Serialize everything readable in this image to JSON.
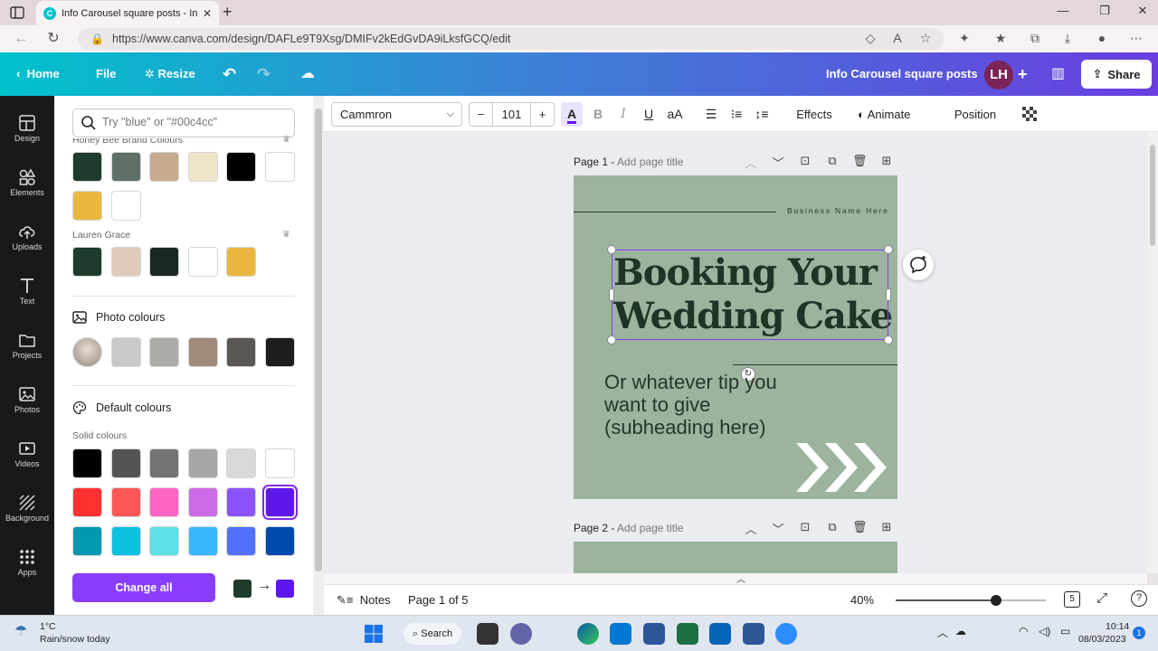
{
  "browser": {
    "tab_title": "Info Carousel square posts - Inst",
    "url": "https://www.canva.com/design/DAFLe9T9Xsg/DMIFv2kEdGvDA9iLksfGCQ/edit"
  },
  "header": {
    "home": "Home",
    "file": "File",
    "resize": "Resize",
    "design_title": "Info Carousel  square posts",
    "avatar_initials": "LH",
    "share": "Share"
  },
  "rail": [
    {
      "label": "Design",
      "icon": "design-icon"
    },
    {
      "label": "Elements",
      "icon": "elements-icon"
    },
    {
      "label": "Uploads",
      "icon": "uploads-icon"
    },
    {
      "label": "Text",
      "icon": "text-icon"
    },
    {
      "label": "Projects",
      "icon": "projects-icon"
    },
    {
      "label": "Photos",
      "icon": "photos-icon"
    },
    {
      "label": "Videos",
      "icon": "videos-icon"
    },
    {
      "label": "Background",
      "icon": "background-icon"
    },
    {
      "label": "Apps",
      "icon": "apps-icon"
    }
  ],
  "panel": {
    "search_placeholder": "Try \"blue\" or \"#00c4cc\"",
    "brand1_title": "Honey Bee Brand Colours",
    "brand1_colors": [
      "#1f3b2c",
      "#5f7067",
      "#c7ab8f",
      "#efe5c9",
      "#000000",
      "#ffffff",
      "#eab83f",
      "#ffffff"
    ],
    "brand2_title": "Lauren Grace",
    "brand2_colors": [
      "#1e3b2b",
      "#dfcbb9",
      "#1a2723",
      "#ffffff",
      "#eab83f"
    ],
    "photo_title": "Photo colours",
    "photo_colors": [
      "#c8c9cb",
      "#adaba8",
      "#a08b7c",
      "#5b5753",
      "#1d1d1d"
    ],
    "default_title": "Default colours",
    "solid_label": "Solid colours",
    "solid_colors": [
      "#000000",
      "#545454",
      "#737373",
      "#a6a6a6",
      "#d9d9d9",
      "#ffffff",
      "#ff3131",
      "#ff5757",
      "#ff66c4",
      "#cb6ce6",
      "#8c52ff",
      "#5e17eb",
      "#0097b2",
      "#0cc0df",
      "#5ce1e6",
      "#38b6ff",
      "#5271ff",
      "#004aad"
    ],
    "selected_solid_index": 11,
    "change_all": "Change all",
    "from_color": "#1f3b2c",
    "to_color": "#5e17eb"
  },
  "toolbar": {
    "font": "Cammron",
    "size": "101",
    "effects": "Effects",
    "animate": "Animate",
    "position": "Position"
  },
  "pages": {
    "page1_label": "Page 1 -",
    "page1_sub": "Add page title",
    "page2_label": "Page 2 -",
    "page2_sub": "Add page title"
  },
  "design": {
    "business_name": "Business Name Here",
    "headline_line1": "Booking Your",
    "headline_line2": "Wedding Cake",
    "sub_line1": "Or whatever tip you",
    "sub_line2": "want to give",
    "sub_line3": "(subheading here)",
    "bg_color": "#9cb39e"
  },
  "bottom": {
    "notes": "Notes",
    "page_indicator": "Page 1 of 5",
    "zoom": "40%",
    "zoom_fraction": 0.4,
    "pages_count": "5"
  },
  "taskbar": {
    "weather_temp": "1°C",
    "weather_desc": "Rain/snow today",
    "search": "Search",
    "time": "10:14",
    "date": "08/03/2023",
    "notification_count": "1"
  }
}
